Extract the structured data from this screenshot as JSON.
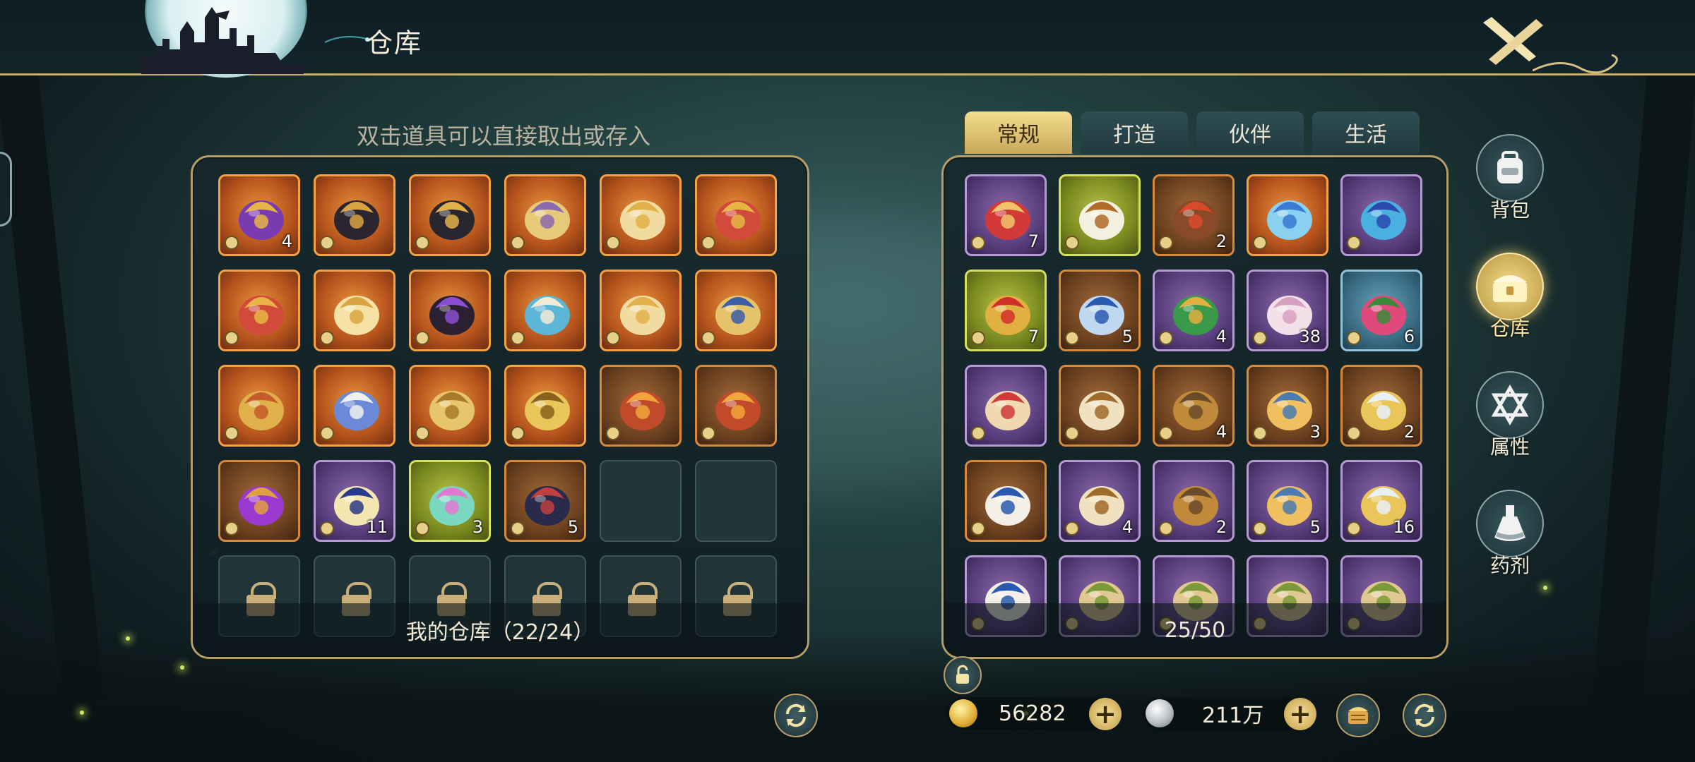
{
  "header": {
    "title": "仓库"
  },
  "hint": "双击道具可以直接取出或存入",
  "left_panel": {
    "footer": "我的仓库（22/24）",
    "slots": [
      {
        "icon": "treasure-chest-icon",
        "rarity": "orange",
        "qty": "4"
      },
      {
        "icon": "dark-armor-icon",
        "rarity": "orange",
        "qty": ""
      },
      {
        "icon": "dark-helmet-icon",
        "rarity": "orange",
        "qty": ""
      },
      {
        "icon": "gold-chestplate-icon",
        "rarity": "orange",
        "qty": ""
      },
      {
        "icon": "gold-boots-icon",
        "rarity": "orange",
        "qty": ""
      },
      {
        "icon": "ruby-amulet-icon",
        "rarity": "orange",
        "qty": ""
      },
      {
        "icon": "ruby-amulet-icon",
        "rarity": "orange",
        "qty": ""
      },
      {
        "icon": "winged-crown-icon",
        "rarity": "orange",
        "qty": ""
      },
      {
        "icon": "dark-robe-icon",
        "rarity": "orange",
        "qty": ""
      },
      {
        "icon": "blue-hat-icon",
        "rarity": "orange",
        "qty": ""
      },
      {
        "icon": "gold-boots-icon",
        "rarity": "orange",
        "qty": ""
      },
      {
        "icon": "gold-armor-icon",
        "rarity": "orange",
        "qty": ""
      },
      {
        "icon": "gold-tiara-icon",
        "rarity": "orange",
        "qty": ""
      },
      {
        "icon": "blue-boots-icon",
        "rarity": "orange",
        "qty": ""
      },
      {
        "icon": "gold-necklace-icon",
        "rarity": "orange",
        "qty": ""
      },
      {
        "icon": "gold-shield-icon",
        "rarity": "orange",
        "qty": ""
      },
      {
        "icon": "magic-book-icon",
        "rarity": "brown",
        "qty": ""
      },
      {
        "icon": "magic-book-icon",
        "rarity": "brown",
        "qty": ""
      },
      {
        "icon": "purple-spellbook-icon",
        "rarity": "brown",
        "qty": ""
      },
      {
        "icon": "masquerade-mask-icon",
        "rarity": "purple",
        "qty": "11"
      },
      {
        "icon": "crystal-pile-icon",
        "rarity": "green",
        "qty": "3"
      },
      {
        "icon": "feather-hat-icon",
        "rarity": "brown",
        "qty": "5"
      },
      {
        "icon": "",
        "rarity": "empty",
        "qty": ""
      },
      {
        "icon": "",
        "rarity": "empty",
        "qty": ""
      },
      {
        "icon": "lock-icon",
        "rarity": "locked",
        "qty": ""
      },
      {
        "icon": "lock-icon",
        "rarity": "locked",
        "qty": ""
      },
      {
        "icon": "lock-icon",
        "rarity": "locked",
        "qty": ""
      },
      {
        "icon": "lock-icon",
        "rarity": "locked",
        "qty": ""
      },
      {
        "icon": "lock-icon",
        "rarity": "locked",
        "qty": ""
      },
      {
        "icon": "lock-icon",
        "rarity": "locked",
        "qty": ""
      }
    ]
  },
  "tabs": [
    {
      "label": "常规",
      "active": true
    },
    {
      "label": "打造",
      "active": false
    },
    {
      "label": "伙伴",
      "active": false
    },
    {
      "label": "生活",
      "active": false
    }
  ],
  "right_panel": {
    "footer": "25/50",
    "slots": [
      {
        "icon": "red-potion-icon",
        "rarity": "purple",
        "qty": "7"
      },
      {
        "icon": "food-plate-icon",
        "rarity": "green",
        "qty": ""
      },
      {
        "icon": "meat-dish-icon",
        "rarity": "brown",
        "qty": "2"
      },
      {
        "icon": "ice-crystal-icon",
        "rarity": "orange",
        "qty": ""
      },
      {
        "icon": "crystal-staff-icon",
        "rarity": "purple",
        "qty": ""
      },
      {
        "icon": "red-star-medal-icon",
        "rarity": "green",
        "qty": "7"
      },
      {
        "icon": "blue-star-medal-icon",
        "rarity": "brown",
        "qty": "5"
      },
      {
        "icon": "green-star-medal-icon",
        "rarity": "purple",
        "qty": "4"
      },
      {
        "icon": "seashell-icon",
        "rarity": "purple",
        "qty": "38"
      },
      {
        "icon": "pink-flower-icon",
        "rarity": "blue",
        "qty": "6"
      },
      {
        "icon": "pudding-icon",
        "rarity": "purple",
        "qty": ""
      },
      {
        "icon": "thread-spool-icon",
        "rarity": "brown",
        "qty": ""
      },
      {
        "icon": "spinning-wheel-icon",
        "rarity": "brown",
        "qty": "4"
      },
      {
        "icon": "lantern-potion-icon",
        "rarity": "brown",
        "qty": "3"
      },
      {
        "icon": "gold-shelf-icon",
        "rarity": "brown",
        "qty": "2"
      },
      {
        "icon": "teapot-spirit-icon",
        "rarity": "brown",
        "qty": ""
      },
      {
        "icon": "thread-spool-icon",
        "rarity": "purple",
        "qty": "4"
      },
      {
        "icon": "spinning-wheel-icon",
        "rarity": "purple",
        "qty": "2"
      },
      {
        "icon": "lantern-potion-icon",
        "rarity": "purple",
        "qty": "5"
      },
      {
        "icon": "gold-shelf-icon",
        "rarity": "purple",
        "qty": "16"
      },
      {
        "icon": "teapot-spirit-icon",
        "rarity": "purple",
        "qty": ""
      },
      {
        "icon": "map-scroll-icon",
        "rarity": "purple",
        "qty": ""
      },
      {
        "icon": "map-scroll-icon",
        "rarity": "purple",
        "qty": ""
      },
      {
        "icon": "map-scroll-icon",
        "rarity": "purple",
        "qty": ""
      },
      {
        "icon": "map-scroll-icon",
        "rarity": "purple",
        "qty": ""
      }
    ]
  },
  "side_menu": [
    {
      "label": "背包",
      "icon": "backpack-icon",
      "active": false
    },
    {
      "label": "仓库",
      "icon": "warehouse-chest-icon",
      "active": true
    },
    {
      "label": "属性",
      "icon": "hexagram-icon",
      "active": false
    },
    {
      "label": "药剂",
      "icon": "potion-flask-icon",
      "active": false
    }
  ],
  "currency": {
    "gold": "56282",
    "silver": "211万"
  },
  "colors": {
    "frame_gold": "#b69c66",
    "tab_active": "#f3dd8e",
    "orange_rarity": "#f3a245",
    "purple_rarity": "#b59ad6",
    "green_rarity": "#d4e060"
  }
}
